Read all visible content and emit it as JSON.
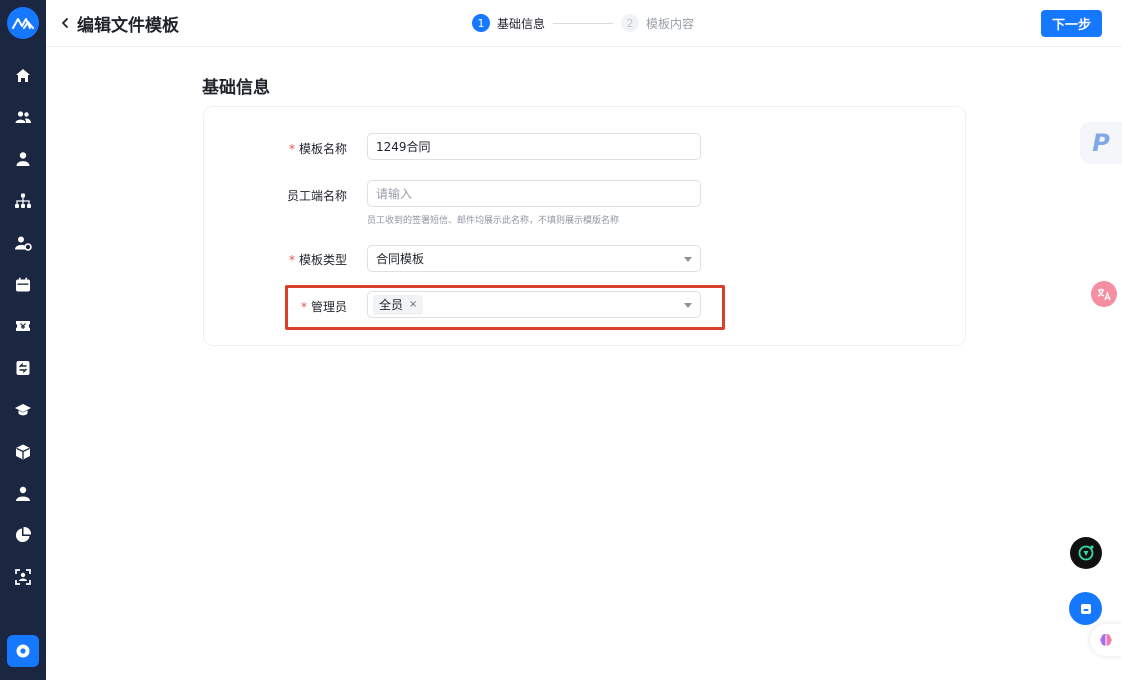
{
  "header": {
    "title": "编辑文件模板",
    "steps": [
      {
        "num": "1",
        "label": "基础信息"
      },
      {
        "num": "2",
        "label": "模板内容"
      }
    ],
    "next_label": "下一步"
  },
  "section": {
    "title": "基础信息"
  },
  "form": {
    "template_name": {
      "required_mark": "*",
      "label": "模板名称",
      "value": "1249合同"
    },
    "employee_name": {
      "label": "员工端名称",
      "placeholder": "请输入",
      "hint": "员工收到的签署短信、邮件均展示此名称，不填则展示模版名称"
    },
    "template_type": {
      "required_mark": "*",
      "label": "模板类型",
      "value": "合同模板"
    },
    "admin": {
      "required_mark": "*",
      "label": "管理员",
      "tag": "全员",
      "tag_close": "×"
    }
  },
  "floating": {
    "p_label": "P"
  },
  "colors": {
    "accent": "#1677ff",
    "sidebar": "#1b2740",
    "highlight": "#d9402a",
    "required": "#f04e4e"
  },
  "icons": {
    "sidebar": [
      "home-icon",
      "group-icon",
      "user-icon",
      "org-chart-icon",
      "user-settings-icon",
      "calendar-icon",
      "ticket-icon",
      "approval-icon",
      "graduation-cap-icon",
      "box-icon",
      "person-icon",
      "pie-chart-icon",
      "face-scan-icon"
    ],
    "bottom": "settings-icon"
  }
}
